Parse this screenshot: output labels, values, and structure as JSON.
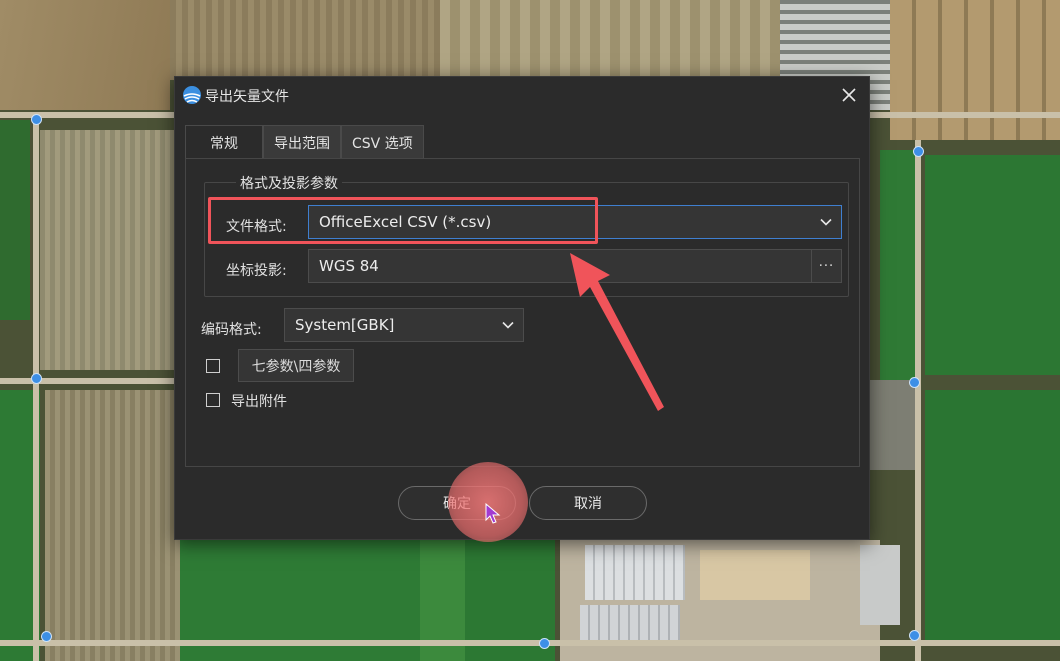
{
  "dialog": {
    "title": "导出矢量文件"
  },
  "tabs": [
    {
      "label": "常规",
      "active": true
    },
    {
      "label": "导出范围",
      "active": false
    },
    {
      "label": "CSV 选项",
      "active": false
    }
  ],
  "group": {
    "title": "格式及投影参数",
    "file_format_label": "文件格式:",
    "file_format_value": "OfficeExcel CSV (*.csv)",
    "projection_label": "坐标投影:",
    "projection_value": "WGS 84",
    "browse_label": "···"
  },
  "encoding": {
    "label": "编码格式:",
    "value": "System[GBK]"
  },
  "seven_param": {
    "checked": false,
    "button_label": "七参数\\四参数"
  },
  "export_attachment": {
    "checked": false,
    "label": "导出附件"
  },
  "footer": {
    "ok_label": "确定",
    "cancel_label": "取消"
  },
  "colors": {
    "dialog_bg": "#2b2b2b",
    "highlight": "#f0545a",
    "focus_border": "#3f7fd0",
    "map_marker": "#3d8fe6"
  }
}
